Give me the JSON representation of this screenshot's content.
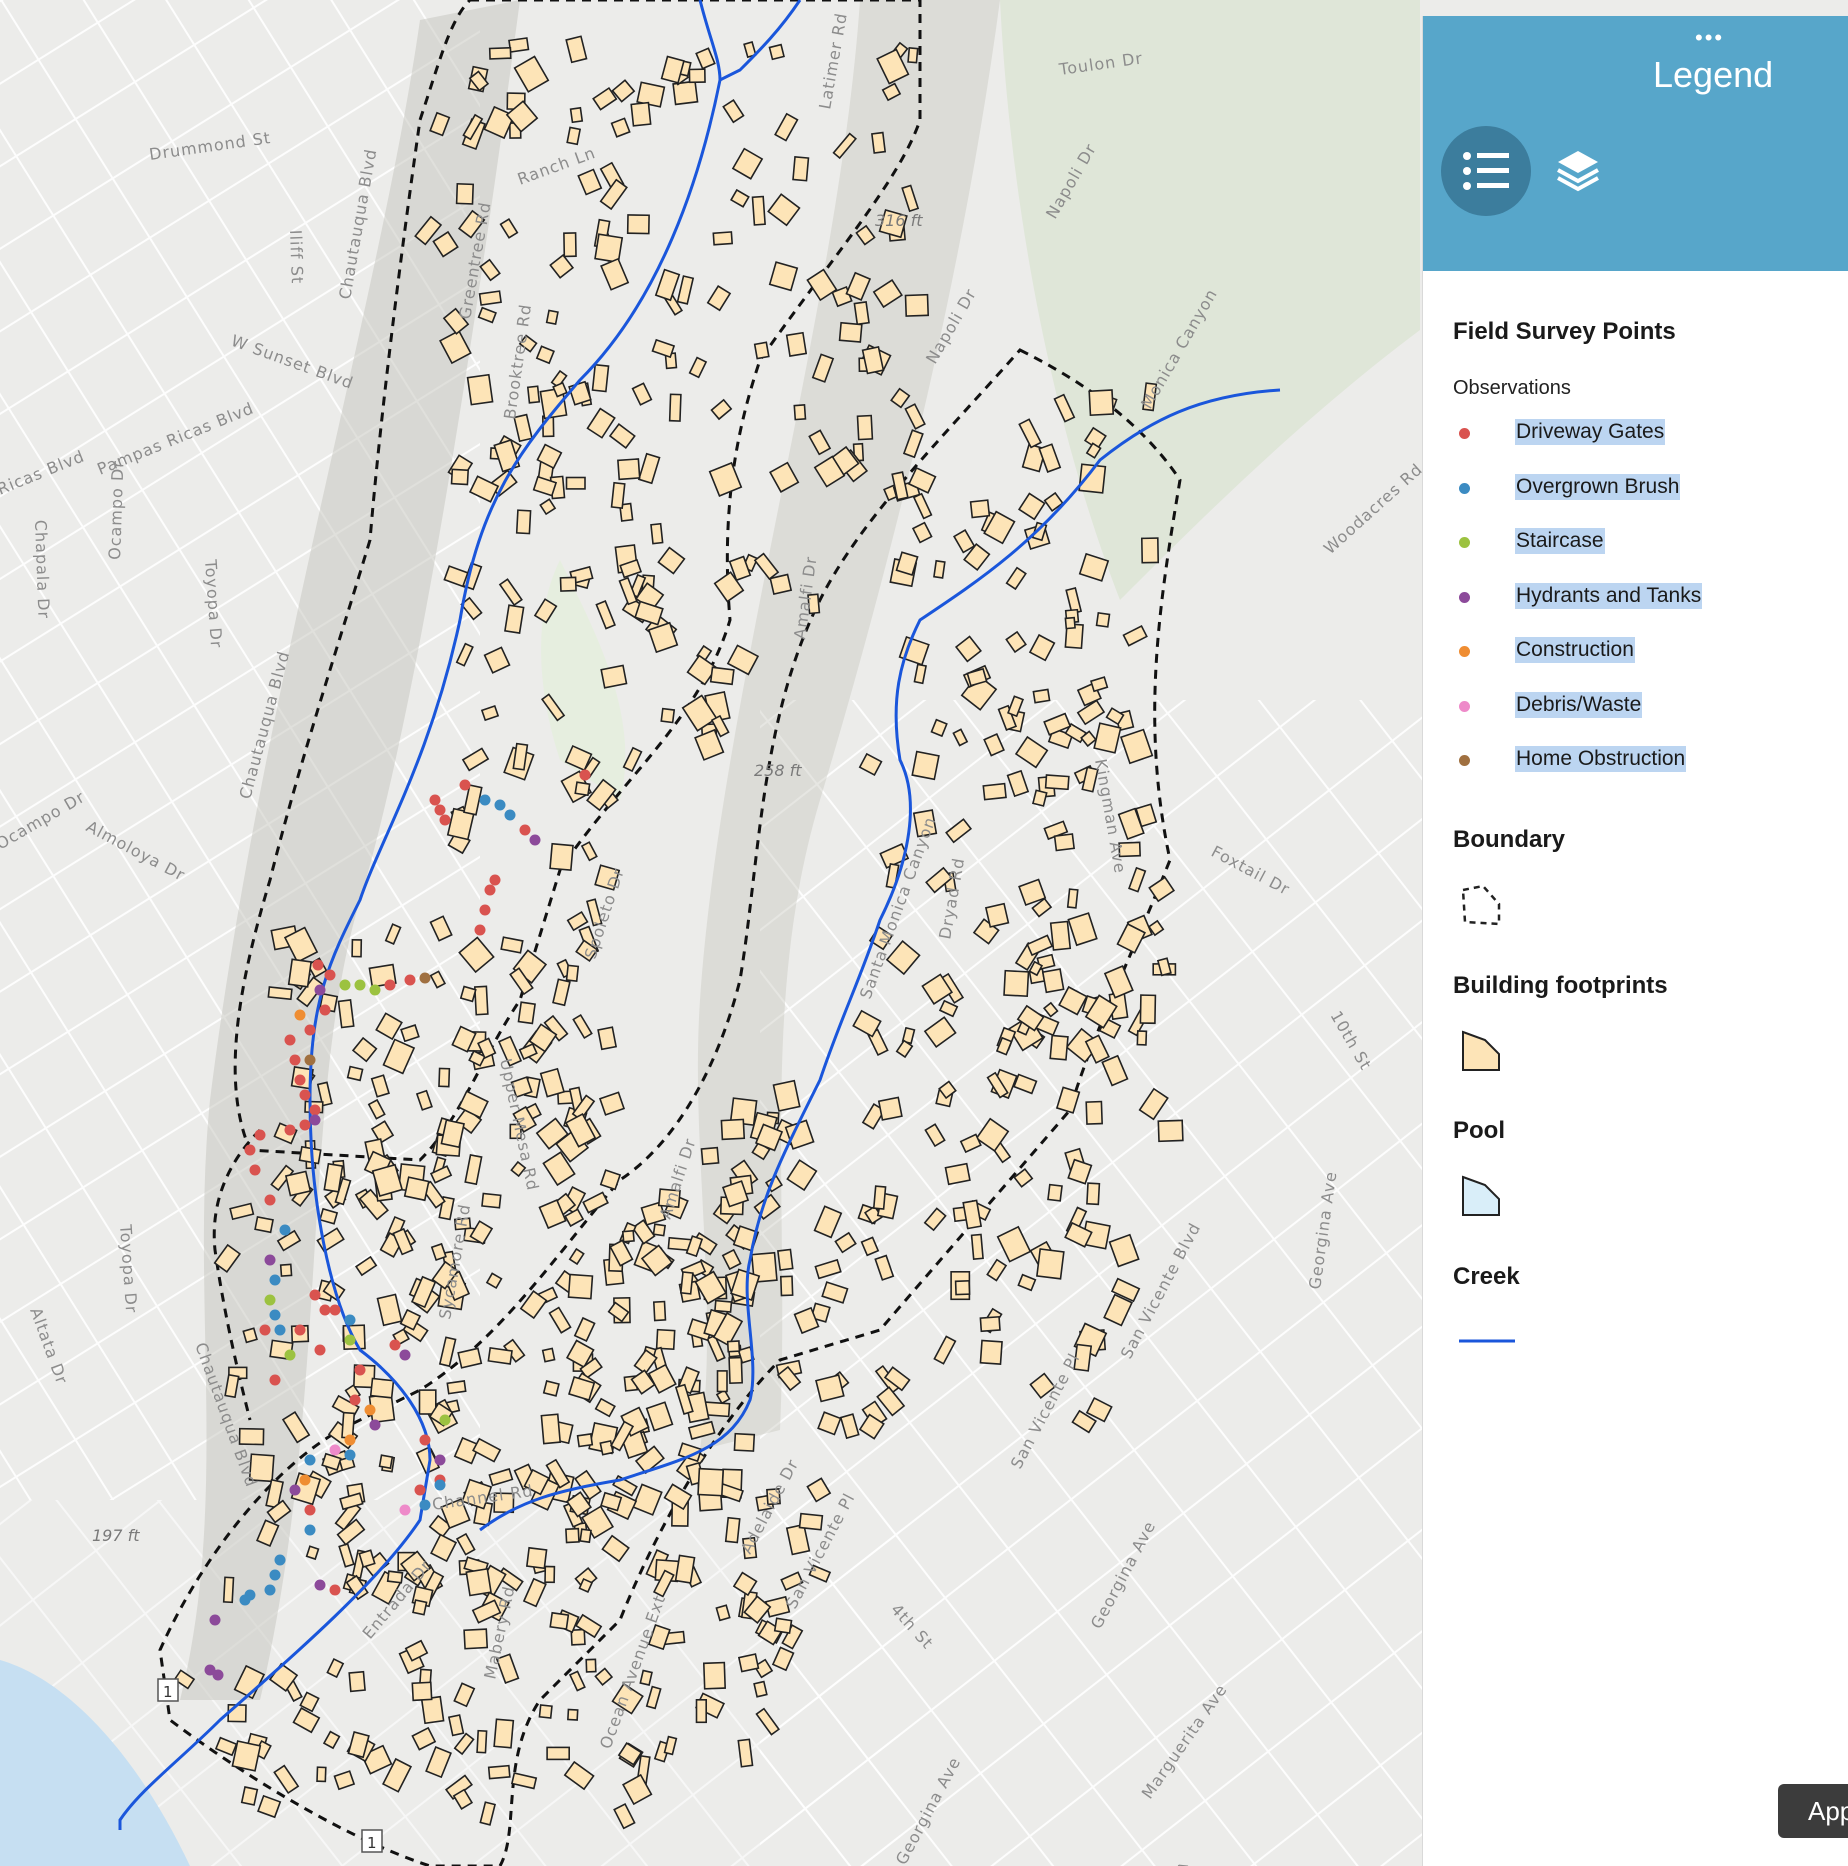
{
  "map": {
    "streets": [
      {
        "name": "Drummond St"
      },
      {
        "name": "Iliff St"
      },
      {
        "name": "Chautauqua Blvd"
      },
      {
        "name": "W Sunset Blvd"
      },
      {
        "name": "Pampas Ricas Blvd"
      },
      {
        "name": "Ricas Blvd"
      },
      {
        "name": "Chapala Dr"
      },
      {
        "name": "Toyopa Dr"
      },
      {
        "name": "Ocampo Dr"
      },
      {
        "name": "Chautauqua Blvd"
      },
      {
        "name": "Almoloya Dr"
      },
      {
        "name": "Ocampo Dr"
      },
      {
        "name": "Toyopa Dr"
      },
      {
        "name": "Altata Dr"
      },
      {
        "name": "Chautauqua Blvd"
      },
      {
        "name": "Greentree Rd"
      },
      {
        "name": "Brooktree Rd"
      },
      {
        "name": "Ranch Ln"
      },
      {
        "name": "Latimer Rd"
      },
      {
        "name": "Toulon Dr"
      },
      {
        "name": "Napoli Dr"
      },
      {
        "name": "Napoli Dr"
      },
      {
        "name": "Amalfi Dr"
      },
      {
        "name": "Spoleto Dr"
      },
      {
        "name": "Monica Canyon"
      },
      {
        "name": "Woodacres Rd"
      },
      {
        "name": "Kingman Ave"
      },
      {
        "name": "Foxtail Dr"
      },
      {
        "name": "10th St"
      },
      {
        "name": "Georgina Ave"
      },
      {
        "name": "San Vicente Blvd"
      },
      {
        "name": "San Vicente Pl"
      },
      {
        "name": "San Vicente Pl"
      },
      {
        "name": "4th St"
      },
      {
        "name": "Georgina Ave"
      },
      {
        "name": "Marguerita Ave"
      },
      {
        "name": "Adelaide Dr"
      },
      {
        "name": "Ocean Avenue Ext"
      },
      {
        "name": "Channel Rd"
      },
      {
        "name": "Entrada Dr"
      },
      {
        "name": "Mabery Rd"
      },
      {
        "name": "Amalfi Dr"
      },
      {
        "name": "Upper Mesa Rd"
      },
      {
        "name": "Sycamore Rd"
      },
      {
        "name": "Dryad Rd"
      },
      {
        "name": "Santa Monica Canyon"
      },
      {
        "name": "Georgina Ave"
      },
      {
        "name": "4th St"
      }
    ],
    "elevations": [
      "316 ft",
      "258 ft",
      "197 ft"
    ],
    "route_shield": "1",
    "colors": {
      "boundary": "#111111",
      "building": "#fde4b7",
      "creek": "#1a56db",
      "park": "#e6eedf",
      "water": "#c6dff2",
      "hillshade": "#c9c9c1"
    }
  },
  "legend": {
    "title": "Legend",
    "tabs": [
      "list-icon",
      "layers-icon"
    ],
    "field_survey_title": "Field Survey Points",
    "observations_label": "Observations",
    "observations": [
      {
        "label": "Driveway Gates",
        "color": "#d9534f"
      },
      {
        "label": "Overgrown Brush",
        "color": "#3b8bc2"
      },
      {
        "label": "Staircase",
        "color": "#9cc240"
      },
      {
        "label": "Hydrants and Tanks",
        "color": "#8c4a9a"
      },
      {
        "label": "Construction",
        "color": "#ef8d32"
      },
      {
        "label": "Debris/Waste",
        "color": "#ee8ac9"
      },
      {
        "label": "Home Obstruction",
        "color": "#a07040"
      }
    ],
    "boundary_title": "Boundary",
    "buildings_title": "Building footprints",
    "pool_title": "Pool",
    "creek_title": "Creek"
  },
  "app_button": "App"
}
